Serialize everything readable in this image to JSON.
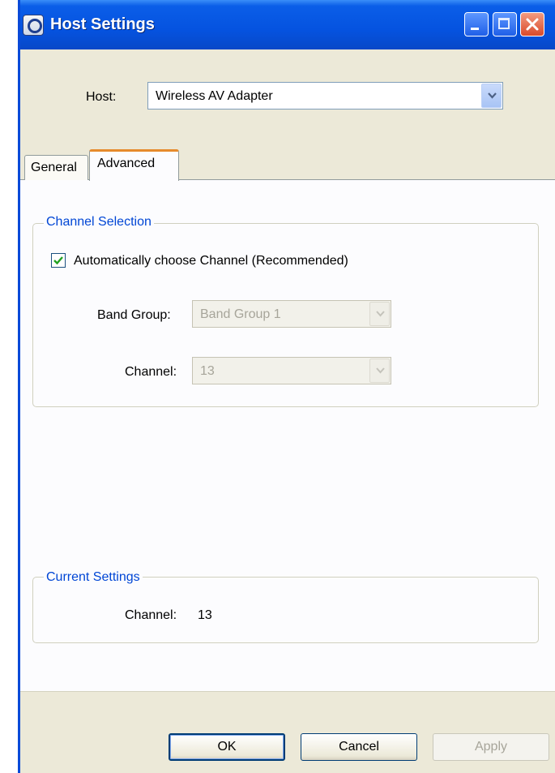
{
  "window": {
    "title": "Host Settings",
    "icon": "app-logo-icon",
    "controls": [
      "minimize-icon",
      "maximize-icon",
      "close-icon"
    ]
  },
  "host": {
    "label": "Host:",
    "selected": "Wireless AV Adapter"
  },
  "tabs": [
    {
      "label": "General",
      "active": false
    },
    {
      "label": "Advanced",
      "active": true
    }
  ],
  "channel_selection": {
    "title": "Channel Selection",
    "auto_checkbox_label": "Automatically choose Channel (Recommended)",
    "auto_checked": true,
    "band_group_label": "Band Group:",
    "band_group_value": "Band Group 1",
    "channel_label": "Channel:",
    "channel_value": "13"
  },
  "current_settings": {
    "title": "Current Settings",
    "channel_label": "Channel:",
    "channel_value": "13"
  },
  "buttons": {
    "ok": "OK",
    "cancel": "Cancel",
    "apply": "Apply"
  },
  "colors": {
    "title_bar": "#0553e0",
    "group_title": "#0046d5",
    "active_tab_accent": "#e68b2c",
    "dialog_background": "#ece9d8"
  }
}
